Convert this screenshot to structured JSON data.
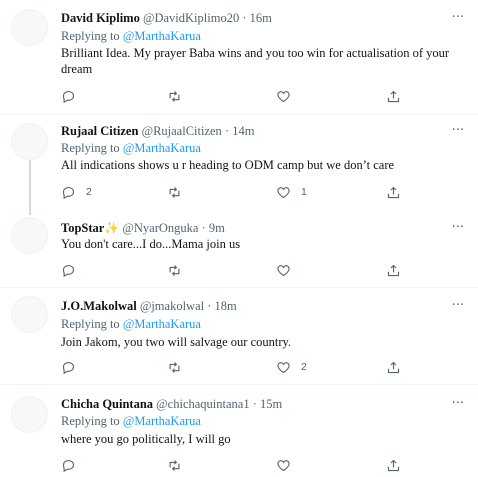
{
  "reply_prefix": "Replying to",
  "more_glyph": "···",
  "tweets": [
    {
      "name": "David Kiplimo",
      "handle": "@DavidKiplimo20",
      "time": "16m",
      "reply_to": "@MarthaKarua",
      "text": "Brilliant Idea. My prayer Baba wins and you too win for actualisation of your dream",
      "replies": "",
      "retweets": "",
      "likes": ""
    },
    {
      "name": "Rujaal Citizen",
      "handle": "@RujaalCitizen",
      "time": "14m",
      "reply_to": "@MarthaKarua",
      "text": "All indications shows u r heading to ODM camp but we don’t care",
      "replies": "2",
      "retweets": "",
      "likes": "1"
    },
    {
      "name": "TopStar",
      "name_emoji": "✨",
      "handle": "@NyarOnguka",
      "time": "9m",
      "reply_to": "",
      "text": "You don't care...I do...Mama join us",
      "replies": "",
      "retweets": "",
      "likes": ""
    },
    {
      "name": "J.O.Makolwal",
      "handle": "@jmakolwal",
      "time": "18m",
      "reply_to": "@MarthaKarua",
      "text": "Join Jakom, you two will salvage our country.",
      "replies": "",
      "retweets": "",
      "likes": "2"
    },
    {
      "name": "Chicha Quintana",
      "handle": "@chichaquintana1",
      "time": "15m",
      "reply_to": "@MarthaKarua",
      "text": "where you go politically, I will go",
      "replies": "",
      "retweets": "",
      "likes": ""
    }
  ]
}
